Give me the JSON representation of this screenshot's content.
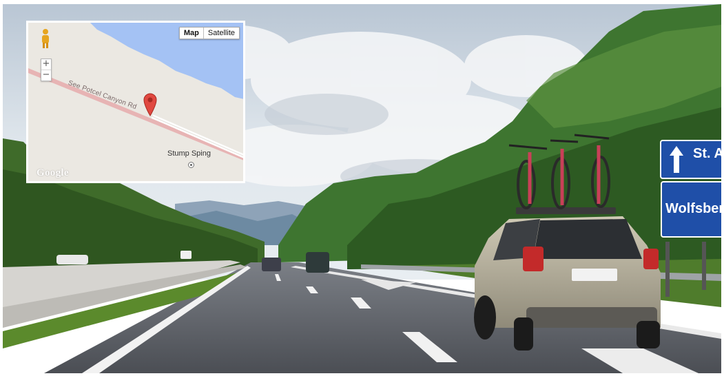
{
  "map": {
    "type_buttons": [
      "Map",
      "Satellite"
    ],
    "road_label": "See Potcel Canyon Rd",
    "place_label": "Stump Sping",
    "zoom_in": "+",
    "zoom_out": "−",
    "logo": "Google"
  },
  "road_signs": {
    "top_sign": "St. A",
    "bottom_sign": "Wolfsber"
  },
  "icons": [
    "pegman-icon",
    "map-pin-icon",
    "place-marker-icon",
    "up-arrow-icon"
  ],
  "colors": {
    "map_land": "#ebe8e2",
    "map_water": "#a4c2f4",
    "map_road": "#e7b4b4",
    "map_pin": "#e04840",
    "sign_blue": "#1f4fa8",
    "sky": "#cfd9e3",
    "road": "#5a5d63",
    "car": "#b7b09b"
  }
}
